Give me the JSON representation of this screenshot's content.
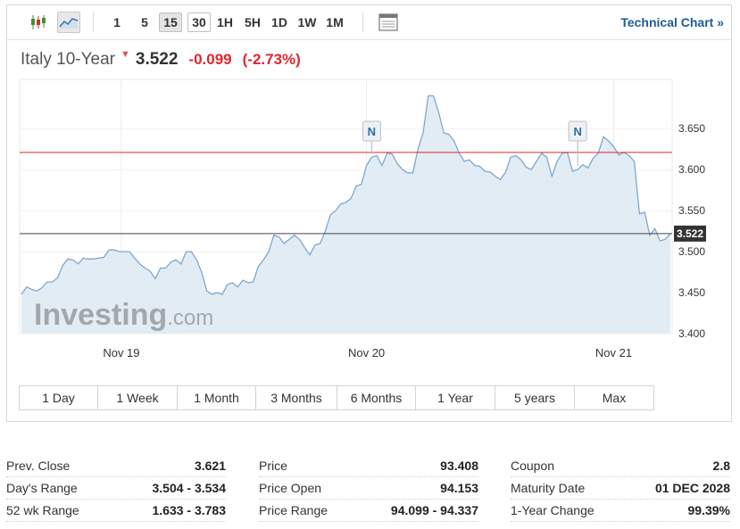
{
  "toolbar": {
    "timeframes": [
      "1",
      "5",
      "15",
      "30",
      "1H",
      "5H",
      "1D",
      "1W",
      "1M"
    ],
    "active_timeframe": "15",
    "technical_link": "Technical Chart »"
  },
  "quote": {
    "name": "Italy 10-Year",
    "last": "3.522",
    "change": "-0.099",
    "change_pct": "(-2.73%)"
  },
  "watermark": "Investing.com",
  "colors": {
    "line": "#7ea7cf",
    "fill": "#e2ecf5",
    "prev_close": "#e0262c",
    "current": "#333333",
    "negative": "#e0262c",
    "link": "#1d5d94"
  },
  "chart_data": {
    "type": "area",
    "title": "Italy 10-Year",
    "xlabel": "",
    "ylabel": "",
    "ylim": [
      3.4,
      3.71
    ],
    "y_ticks": [
      "3.650",
      "3.600",
      "3.550",
      "3.500",
      "3.450",
      "3.400"
    ],
    "x_ticks": [
      "Nov 19",
      "Nov 20",
      "Nov 21"
    ],
    "x_tick_index": [
      19.4,
      67.0,
      115.0
    ],
    "prev_close": 3.621,
    "current_value": 3.522,
    "current_label": "3.522",
    "news_markers": [
      {
        "label": "N",
        "index": 68
      },
      {
        "label": "N",
        "index": 108
      }
    ],
    "series": [
      {
        "values": [
          3.448,
          3.457,
          3.454,
          3.452,
          3.456,
          3.463,
          3.463,
          3.468,
          3.483,
          3.491,
          3.49,
          3.485,
          3.492,
          3.491,
          3.491,
          3.492,
          3.493,
          3.502,
          3.502,
          3.5,
          3.5,
          3.5,
          3.492,
          3.485,
          3.48,
          3.476,
          3.467,
          3.48,
          3.48,
          3.487,
          3.49,
          3.485,
          3.5,
          3.5,
          3.49,
          3.475,
          3.452,
          3.448,
          3.45,
          3.448,
          3.46,
          3.462,
          3.457,
          3.465,
          3.462,
          3.463,
          3.482,
          3.49,
          3.5,
          3.52,
          3.518,
          3.51,
          3.515,
          3.52,
          3.515,
          3.505,
          3.496,
          3.508,
          3.51,
          3.525,
          3.545,
          3.55,
          3.558,
          3.56,
          3.565,
          3.58,
          3.582,
          3.605,
          3.615,
          3.617,
          3.605,
          3.62,
          3.619,
          3.607,
          3.6,
          3.596,
          3.596,
          3.625,
          3.645,
          3.69,
          3.69,
          3.67,
          3.645,
          3.643,
          3.635,
          3.62,
          3.61,
          3.612,
          3.605,
          3.604,
          3.598,
          3.597,
          3.592,
          3.588,
          3.597,
          3.615,
          3.617,
          3.612,
          3.603,
          3.6,
          3.61,
          3.62,
          3.615,
          3.592,
          3.61,
          3.62,
          3.621,
          3.598,
          3.6,
          3.606,
          3.602,
          3.614,
          3.62,
          3.64,
          3.635,
          3.628,
          3.618,
          3.621,
          3.617,
          3.61,
          3.546,
          3.548,
          3.52,
          3.528,
          3.513,
          3.515,
          3.522
        ]
      }
    ]
  },
  "range_buttons": [
    "1 Day",
    "1 Week",
    "1 Month",
    "3 Months",
    "6 Months",
    "1 Year",
    "5 years",
    "Max"
  ],
  "stats": {
    "col1": [
      {
        "label": "Prev. Close",
        "value": "3.621"
      },
      {
        "label": "Day's Range",
        "value": "3.504 - 3.534"
      },
      {
        "label": "52 wk Range",
        "value": "1.633 - 3.783"
      }
    ],
    "col2": [
      {
        "label": "Price",
        "value": "93.408"
      },
      {
        "label": "Price Open",
        "value": "94.153"
      },
      {
        "label": "Price Range",
        "value": "94.099 - 94.337"
      }
    ],
    "col3": [
      {
        "label": "Coupon",
        "value": "2.8"
      },
      {
        "label": "Maturity Date",
        "value": "01 DEC 2028"
      },
      {
        "label": "1-Year Change",
        "value": "99.39%"
      }
    ]
  }
}
